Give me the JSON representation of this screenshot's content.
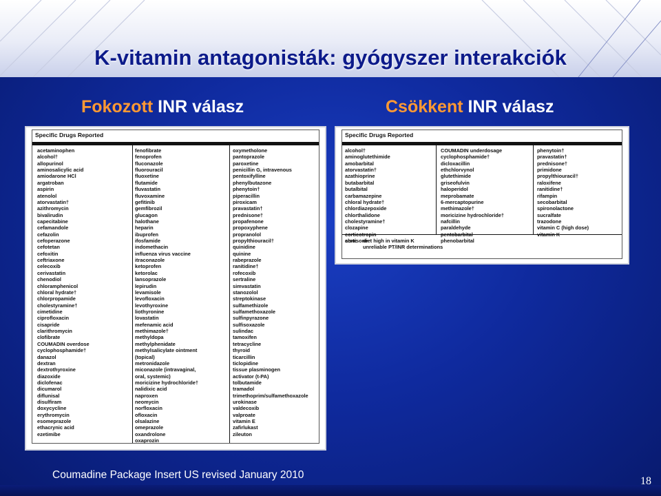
{
  "title": "K-vitamin antagonisták: gyógyszer interakciók",
  "left_header": {
    "prefix": "Fokozott",
    "suffix": "INR válasz"
  },
  "right_header": {
    "prefix": "Csökkent",
    "suffix": "INR válasz"
  },
  "left_table": {
    "heading": "Specific Drugs Reported",
    "columns": [
      [
        "acetaminophen",
        "alcohol†",
        "allopurinol",
        "aminosalicylic acid",
        "amiodarone HCl",
        "argatroban",
        "aspirin",
        "atenolol",
        "atorvastatin†",
        "azithromycin",
        "bivalirudin",
        "capecitabine",
        "cefamandole",
        "cefazolin",
        "cefoperazone",
        "cefotetan",
        "cefoxitin",
        "ceftriaxone",
        "celecoxib",
        "cerivastatin",
        "chenodiol",
        "chloramphenicol",
        "chloral hydrate†",
        "chlorpropamide",
        "cholestyramine†",
        "cimetidine",
        "ciprofloxacin",
        "cisapride",
        "clarithromycin",
        "clofibrate",
        "COUMADIN overdose",
        "cyclophosphamide†",
        "danazol",
        "dextran",
        "dextrothyroxine",
        "diazoxide",
        "diclofenac",
        "dicumarol",
        "diflunisal",
        "disulfiram",
        "doxycycline",
        "erythromycin",
        "esomeprazole",
        "ethacrynic acid",
        "ezetimibe"
      ],
      [
        "fenofibrate",
        "fenoprofen",
        "fluconazole",
        "fluorouracil",
        "fluoxetine",
        "flutamide",
        "fluvastatin",
        "fluvoxamine",
        "gefitinib",
        "gemfibrozil",
        "glucagon",
        "halothane",
        "heparin",
        "ibuprofen",
        "ifosfamide",
        "indomethacin",
        "influenza virus vaccine",
        "itraconazole",
        "ketoprofen",
        "ketorolac",
        "lansoprazole",
        "lepirudin",
        "levamisole",
        "levofloxacin",
        "levothyroxine",
        "liothyronine",
        "lovastatin",
        "mefenamic acid",
        "methimazole†",
        "methyldopa",
        "methylphenidate",
        "methylsalicylate ointment",
        "   (topical)",
        "metronidazole",
        "miconazole (intravaginal,",
        "   oral, systemic)",
        "moricizine hydrochloride†",
        "nalidixic acid",
        "naproxen",
        "neomycin",
        "norfloxacin",
        "ofloxacin",
        "olsalazine",
        "omeprazole",
        "oxandrolone",
        "oxaprozin"
      ],
      [
        "oxymetholone",
        "pantoprazole",
        "paroxetine",
        "penicillin G, intravenous",
        "pentoxifylline",
        "phenylbutazone",
        "phenytoin†",
        "piperacillin",
        "piroxicam",
        "pravastatin†",
        "prednisone†",
        "propafenone",
        "propoxyphene",
        "propranolol",
        "propylthiouracil†",
        "quinidine",
        "quinine",
        "rabeprazole",
        "ranitidine†",
        "rofecoxib",
        "sertraline",
        "simvastatin",
        "stanozolol",
        "streptokinase",
        "sulfamethizole",
        "sulfamethoxazole",
        "sulfinpyrazone",
        "sulfisoxazole",
        "sulindac",
        "tamoxifen",
        "tetracycline",
        "thyroid",
        "ticarcillin",
        "ticlopidine",
        "tissue plasminogen",
        "   activator (t-PA)",
        "tolbutamide",
        "tramadol",
        "trimethoprim/sulfamethoxazole",
        "urokinase",
        "valdecoxib",
        "valproate",
        "vitamin E",
        "zafirlukast",
        "zileuton"
      ]
    ]
  },
  "right_table": {
    "heading": "Specific Drugs Reported",
    "columns": [
      [
        "alcohol†",
        "aminoglutethimide",
        "amobarbital",
        "atorvastatin†",
        "azathioprine",
        "butabarbital",
        "butalbital",
        "carbamazepine",
        "chloral hydrate†",
        "chlordiazepoxide",
        "chlorthalidone",
        "cholestyramine†",
        "clozapine",
        "corticotropin",
        "cortisone"
      ],
      [
        "COUMADIN underdosage",
        "cyclophosphamide†",
        "dicloxacillin",
        "ethchlorvynol",
        "glutethimide",
        "griseofulvin",
        "haloperidol",
        "meprobamate",
        "6-mercaptopurine",
        "methimazole†",
        "moricizine hydrochloride†",
        "nafcillin",
        "paraldehyde",
        "pentobarbital",
        "phenobarbital"
      ],
      [
        "phenytoin†",
        "pravastatin†",
        "prednisone†",
        "primidone",
        "propylthiouracil†",
        "raloxifene",
        "ranitidine†",
        "rifampin",
        "secobarbital",
        "spironolactone",
        "sucralfate",
        "trazodone",
        "vitamin C (high dose)",
        "vitamin K"
      ]
    ],
    "also_label": "also:",
    "also_items": [
      "diet high in vitamin K",
      "unreliable PT/INR determinations"
    ]
  },
  "source": "Coumadine Package Insert US revised January 2010",
  "page_number": "18",
  "colors": {
    "background": "#1236b4",
    "title": "#0c1a8a",
    "header_accent": "#ff9933",
    "header_text": "#ffffff"
  }
}
